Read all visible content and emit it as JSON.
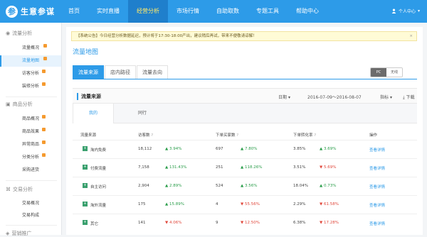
{
  "app": {
    "logo_char": "参",
    "logo_text": "生意参谋"
  },
  "nav": [
    "首页",
    "实时直播",
    "经营分析",
    "市场行情",
    "自助取数",
    "专题工具",
    "帮助中心"
  ],
  "user": {
    "label": "个人中心"
  },
  "sidebar": {
    "groups": [
      {
        "label": "流量分析"
      },
      {
        "label": "商品分析"
      },
      {
        "label": "交易分析"
      },
      {
        "label": "营销推广"
      }
    ],
    "items": [
      "流量概况",
      "流量地图",
      "访客分析",
      "装修分析",
      "商品概况",
      "商品效果",
      "异常商品",
      "分类分析",
      "采购进货",
      "交易概况",
      "交易构成"
    ]
  },
  "notice": {
    "text": "【系统公告】今日经营分析数据延迟，预计将于17:30-18:00产出，建议稍后再试，带来不便敬请谅解！",
    "close": "×"
  },
  "page": {
    "title": "流量地图"
  },
  "tabs": [
    "流量来源",
    "店内路径",
    "流量去向"
  ],
  "device": [
    "PC",
    "无线"
  ],
  "section": {
    "title": "流量来源",
    "date_label": "日期",
    "date_range": "2016-07-09～2016-08-07",
    "metric": "指标",
    "download": "下载"
  },
  "subtabs": [
    "我的",
    "同行"
  ],
  "table": {
    "headers": [
      "流量来源",
      "访客数",
      "下单买家数",
      "下单转化率",
      "操作"
    ],
    "rows": [
      {
        "source": "淘内免费",
        "visitors": "18,112",
        "visitors_change": "3.94%",
        "visitors_dir": "up",
        "buyers": "697",
        "buyers_change": "7.80%",
        "buyers_dir": "up",
        "rate": "3.85%",
        "rate_change": "3.69%",
        "rate_dir": "up",
        "action": "查看详情"
      },
      {
        "source": "付费流量",
        "visitors": "7,158",
        "visitors_change": "131.43%",
        "visitors_dir": "up",
        "buyers": "251",
        "buyers_change": "118.26%",
        "buyers_dir": "up",
        "rate": "3.51%",
        "rate_change": "5.69%",
        "rate_dir": "down",
        "action": "查看详情"
      },
      {
        "source": "自主访问",
        "visitors": "2,904",
        "visitors_change": "2.89%",
        "visitors_dir": "up",
        "buyers": "524",
        "buyers_change": "3.56%",
        "buyers_dir": "up",
        "rate": "18.04%",
        "rate_change": "0.73%",
        "rate_dir": "up",
        "action": "查看详情"
      },
      {
        "source": "淘外流量",
        "visitors": "175",
        "visitors_change": "15.89%",
        "visitors_dir": "up",
        "buyers": "4",
        "buyers_change": "55.56%",
        "buyers_dir": "down",
        "rate": "2.29%",
        "rate_change": "61.58%",
        "rate_dir": "down",
        "action": "查看详情"
      },
      {
        "source": "其它",
        "visitors": "141",
        "visitors_change": "4.06%",
        "visitors_dir": "down",
        "buyers": "9",
        "buyers_change": "12.50%",
        "buyers_dir": "down",
        "rate": "6.38%",
        "rate_change": "17.28%",
        "rate_dir": "down",
        "action": "查看详情"
      }
    ]
  }
}
